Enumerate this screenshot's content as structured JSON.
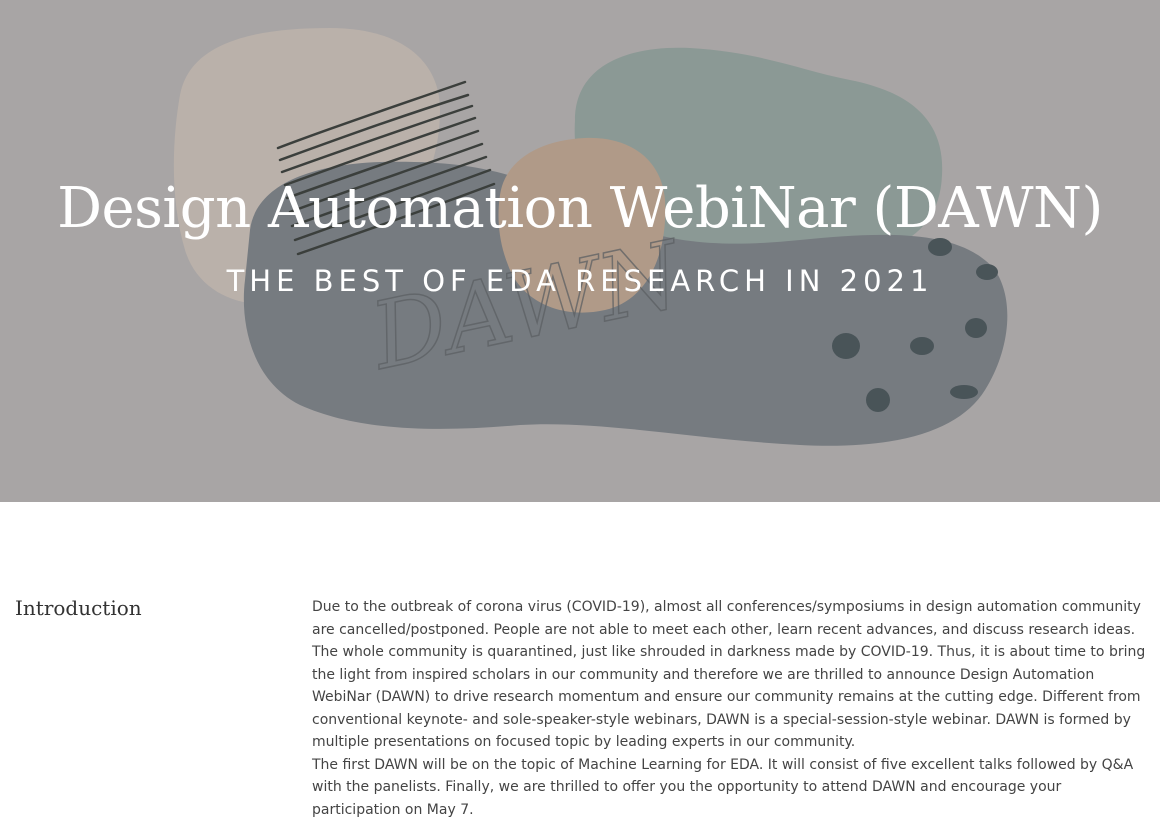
{
  "hero": {
    "title": "Design Automation WebiNar (DAWN)",
    "subtitle": "THE BEST OF EDA RESEARCH IN 2021",
    "artwork_lettering": "DAWN"
  },
  "introduction": {
    "heading": "Introduction",
    "paragraphs": [
      "Due to the outbreak of corona virus (COVID-19), almost all conferences/symposiums in design automation community are cancelled/postponed. People are not able to meet each other, learn recent advances, and discuss research ideas. The whole community is quarantined, just like shrouded in darkness made by COVID-19. Thus, it is about time to bring the light from inspired scholars in our community and therefore we are thrilled to announce Design Automation WebiNar (DAWN) to drive research momentum and ensure our community remains at the cutting edge. Different from conventional keynote- and sole-speaker-style webinars, DAWN is a special-session-style webinar. DAWN is formed by multiple presentations on focused topic by leading experts in our community.",
      "The first DAWN will be on the topic of Machine Learning for EDA. It will consist of five excellent talks followed by Q&A with the panelists. Finally, we are thrilled to offer you the opportunity to attend DAWN and encourage your participation on May 7."
    ]
  },
  "colors": {
    "hero_background": "#a8a5a5",
    "blob_beige": "#bdb3aa",
    "blob_teal": "#8b9995",
    "blob_slate": "#767b80",
    "blob_tan": "#b09a88",
    "text_dark": "#444444"
  }
}
